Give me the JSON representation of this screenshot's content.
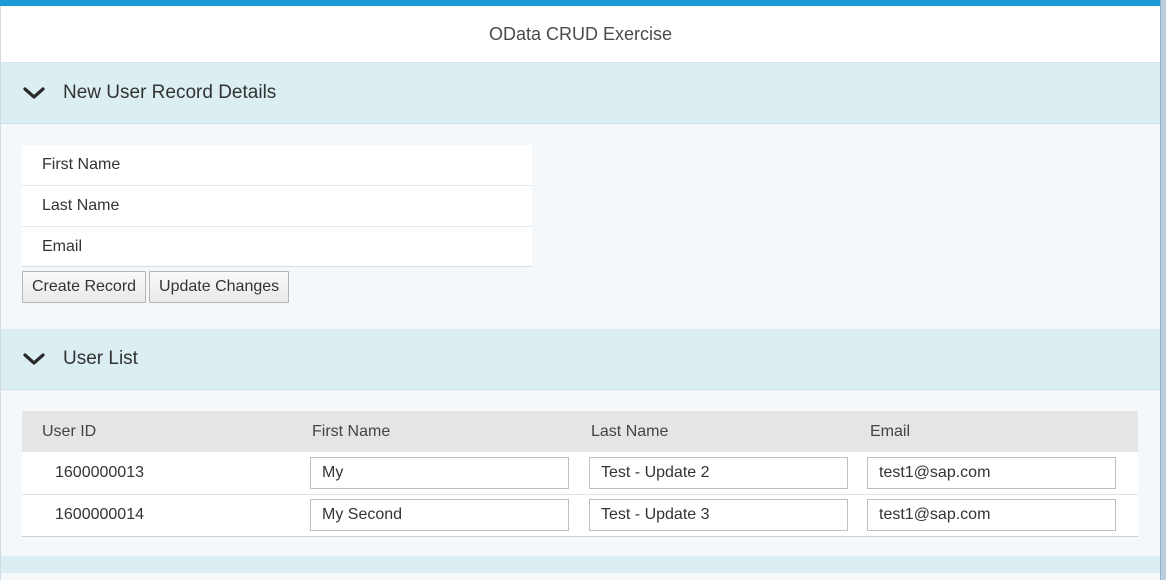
{
  "app": {
    "title": "OData CRUD Exercise"
  },
  "new_user_panel": {
    "title": "New User Record Details",
    "chevron_icon": "chevron-down-icon",
    "fields": [
      {
        "label": "First Name"
      },
      {
        "label": "Last Name"
      },
      {
        "label": "Email"
      }
    ],
    "buttons": {
      "create_label": "Create Record",
      "update_label": "Update Changes"
    }
  },
  "user_list_panel": {
    "title": "User List",
    "chevron_icon": "chevron-down-icon",
    "columns": [
      "User ID",
      "First Name",
      "Last Name",
      "Email"
    ],
    "rows": [
      {
        "user_id": "1600000013",
        "first_name": "My",
        "last_name": "Test - Update 2",
        "email": "test1@sap.com"
      },
      {
        "user_id": "1600000014",
        "first_name": "My Second",
        "last_name": "Test - Update 3",
        "email": "test1@sap.com"
      }
    ]
  },
  "colors": {
    "accent": "#1a9bd7",
    "panel_header_bg": "#dbeef2",
    "page_bg": "#f4f8fa",
    "table_header_bg": "#e5e5e5"
  }
}
